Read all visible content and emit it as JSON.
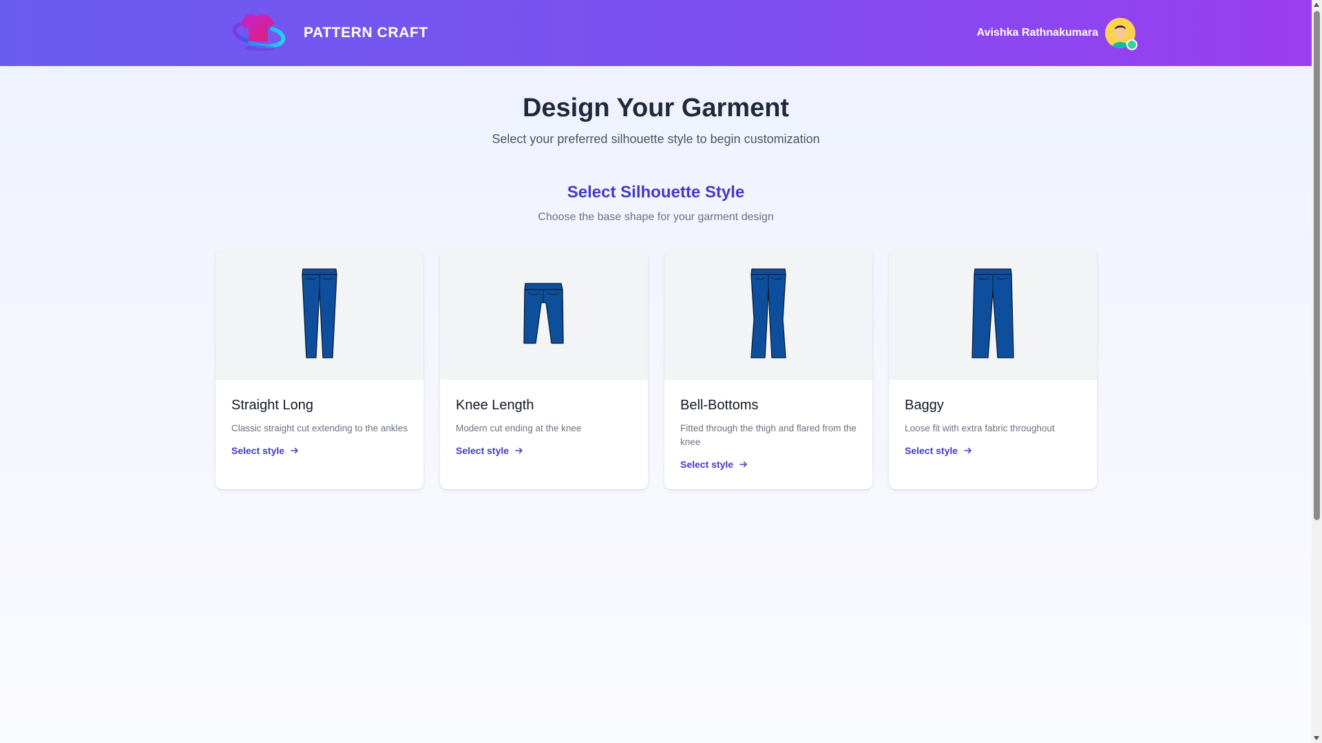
{
  "header": {
    "brand_name": "PATTERN CRAFT",
    "user_name": "Avishka Rathnakumara",
    "accent_gradient": [
      "#6b5cf0",
      "#9a3df0"
    ]
  },
  "main": {
    "title": "Design Your Garment",
    "subtitle": "Select your preferred silhouette style to begin customization",
    "section_title": "Select Silhouette Style",
    "section_subtitle": "Choose the base shape for your garment design"
  },
  "cards": [
    {
      "title": "Straight Long",
      "description": "Classic straight cut extending to the ankles",
      "link": "Select style",
      "icon": "straight-long-jeans-icon"
    },
    {
      "title": "Knee Length",
      "description": "Modern cut ending at the knee",
      "link": "Select style",
      "icon": "knee-length-jeans-icon"
    },
    {
      "title": "Bell-Bottoms",
      "description": "Fitted through the thigh and flared from the knee",
      "link": "Select style",
      "icon": "bell-bottom-jeans-icon"
    },
    {
      "title": "Baggy",
      "description": "Loose fit with extra fabric throughout",
      "link": "Select style",
      "icon": "baggy-jeans-icon"
    }
  ],
  "colors": {
    "denim": "#0d4f9c",
    "link": "#4338ca",
    "online_status": "#34d399"
  }
}
